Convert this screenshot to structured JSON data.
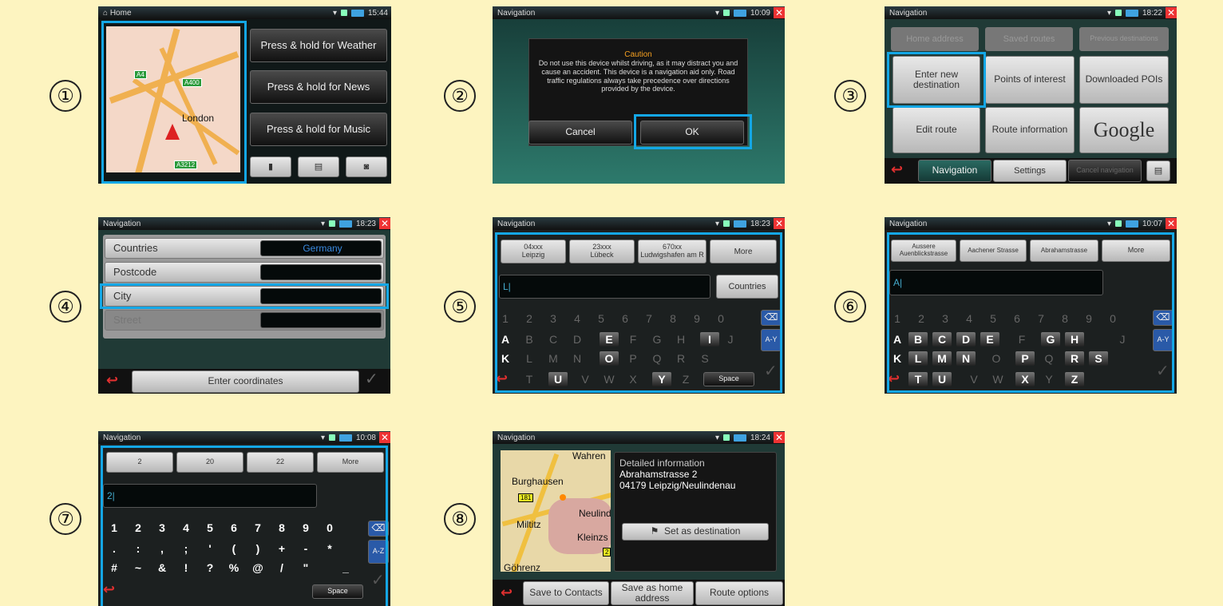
{
  "steps": [
    "①",
    "②",
    "③",
    "④",
    "⑤",
    "⑥",
    "⑦",
    "⑧"
  ],
  "s1": {
    "title": "Home",
    "time": "15:44",
    "weather": "Press & hold for Weather",
    "news": "Press & hold for News",
    "music": "Press & hold for Music",
    "map_city": "London",
    "road1": "A4",
    "road2": "A400",
    "road3": "A3212"
  },
  "s2": {
    "title": "Navigation",
    "time": "10:09",
    "caution_title": "Caution",
    "caution_text": "Do not use this device whilst driving, as it may distract you and cause an accident. This device is a navigation aid only. Road traffic regulations always take precedence over directions provided by the device.",
    "cancel": "Cancel",
    "ok": "OK"
  },
  "s3": {
    "title": "Navigation",
    "time": "18:22",
    "home_address": "Home address",
    "saved_routes": "Saved routes",
    "previous_destinations": "Previous destinations",
    "enter_new_destination": "Enter new destination",
    "points_of_interest": "Points of interest",
    "downloaded_pois": "Downloaded POIs",
    "edit_route": "Edit route",
    "route_information": "Route information",
    "google": "Google",
    "tab_navigation": "Navigation",
    "tab_settings": "Settings",
    "cancel_navigation": "Cancel navigation"
  },
  "s4": {
    "title": "Navigation",
    "time": "18:23",
    "countries": "Countries",
    "country_value": "Germany",
    "postcode": "Postcode",
    "city": "City",
    "street": "Street",
    "enter_coordinates": "Enter coordinates"
  },
  "s5": {
    "title": "Navigation",
    "time": "18:23",
    "sugg": [
      {
        "c": "04xxx",
        "n": "Leipzig"
      },
      {
        "c": "23xxx",
        "n": "Lübeck"
      },
      {
        "c": "670xx",
        "n": "Ludwigshafen am R"
      }
    ],
    "more": "More",
    "input": "L|",
    "countries": "Countries",
    "space": "Space",
    "abc": "A-Y"
  },
  "s6": {
    "title": "Navigation",
    "time": "10:07",
    "sugg": [
      "Aussere Auenblickstrasse",
      "Aachener Strasse",
      "Abrahamstrasse"
    ],
    "more": "More",
    "input": "A|",
    "abc": "A-Y"
  },
  "s7": {
    "title": "Navigation",
    "time": "10:08",
    "sugg": [
      "2",
      "20",
      "22"
    ],
    "more": "More",
    "input": "2|",
    "space": "Space",
    "abc": "A-Z",
    "row1": [
      "1",
      "2",
      "3",
      "4",
      "5",
      "6",
      "7",
      "8",
      "9",
      "0"
    ],
    "row2": [
      ".",
      ":",
      ",",
      ";",
      "'",
      "(",
      ")",
      "+",
      "-",
      "*"
    ],
    "row3": [
      "#",
      "~",
      "&",
      "!",
      "?",
      "%",
      "@",
      "/",
      "\"",
      "_"
    ]
  },
  "s8": {
    "title": "Navigation",
    "time": "18:24",
    "info_title": "Detailed information",
    "street": "Abrahamstrasse 2",
    "city": "04179 Leipzig/Neulindenau",
    "set_dest": "Set as destination",
    "save_contacts": "Save to Contacts",
    "save_home": "Save as home address",
    "route_options": "Route options",
    "m1": "Wahren",
    "m2": "Burghausen",
    "m3": "Neulinde",
    "m4": "Miltitz",
    "m5": "Kleinzs",
    "m6": "Göhrenz",
    "m7": "181",
    "m8": "2"
  }
}
